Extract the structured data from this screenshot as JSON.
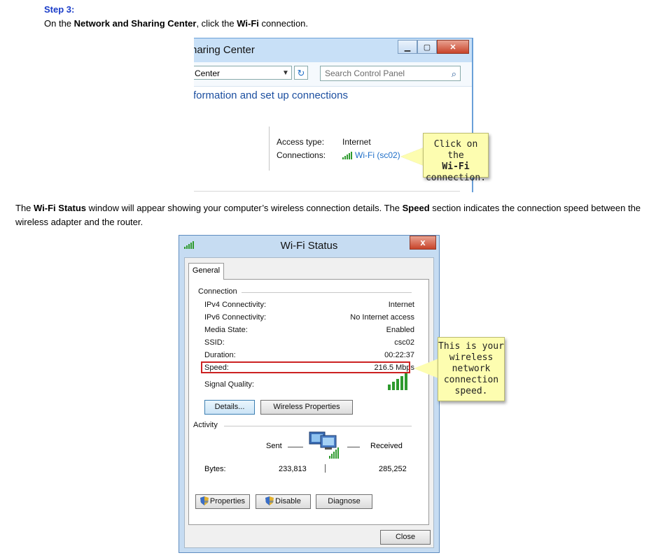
{
  "step": {
    "title": "Step 3:",
    "instruction_prefix": "On the ",
    "instruction_bold1": "Network and Sharing Center",
    "instruction_mid": ", click the ",
    "instruction_bold2": "Wi-Fi",
    "instruction_suffix": " connection."
  },
  "nsc": {
    "title": "haring Center",
    "address": "Center",
    "search_placeholder": "Search Control Panel",
    "heading": "formation and set up connections",
    "access_type_label": "Access type:",
    "access_type_value": "Internet",
    "connections_label": "Connections:",
    "connections_value": "Wi-Fi (sc02)",
    "callout_line1": "Click on the",
    "callout_line2": "Wi-Fi",
    "callout_line3": "connection."
  },
  "paragraph": {
    "p1": "The ",
    "b1": "Wi-Fi Status",
    "p2": " window will appear showing your computer’s wireless connection details.  The ",
    "b2": "Speed",
    "p3": " section indicates the connection speed between the wireless adapter and the router."
  },
  "wifi_status": {
    "title": "Wi-Fi Status",
    "close_glyph": "x",
    "tab": "General",
    "connection_section": "Connection",
    "rows": [
      {
        "label": "IPv4 Connectivity:",
        "value": "Internet"
      },
      {
        "label": "IPv6 Connectivity:",
        "value": "No Internet access"
      },
      {
        "label": "Media State:",
        "value": "Enabled"
      },
      {
        "label": "SSID:",
        "value": "csc02"
      },
      {
        "label": "Duration:",
        "value": "00:22:37"
      },
      {
        "label": "Speed:",
        "value": "216.5 Mbps"
      }
    ],
    "signal_label": "Signal Quality:",
    "signal_bars_filled": 5,
    "details_button": "Details...",
    "wireless_props_button": "Wireless Properties",
    "activity_section": "Activity",
    "sent_label": "Sent",
    "received_label": "Received",
    "bytes_label": "Bytes:",
    "bytes_sent": "233,813",
    "bytes_received": "285,252",
    "properties_button": "Properties",
    "disable_button": "Disable",
    "diagnose_button": "Diagnose",
    "close_button": "Close",
    "callout_lines": [
      "This is your",
      "wireless",
      "network",
      "connection",
      "speed."
    ]
  },
  "colors": {
    "step_blue": "#1a3cc8",
    "link_blue": "#1f6fc8",
    "callout_yellow": "#fdfdb0",
    "highlight_red": "#cc2222",
    "signal_green": "#2e9a2e"
  }
}
